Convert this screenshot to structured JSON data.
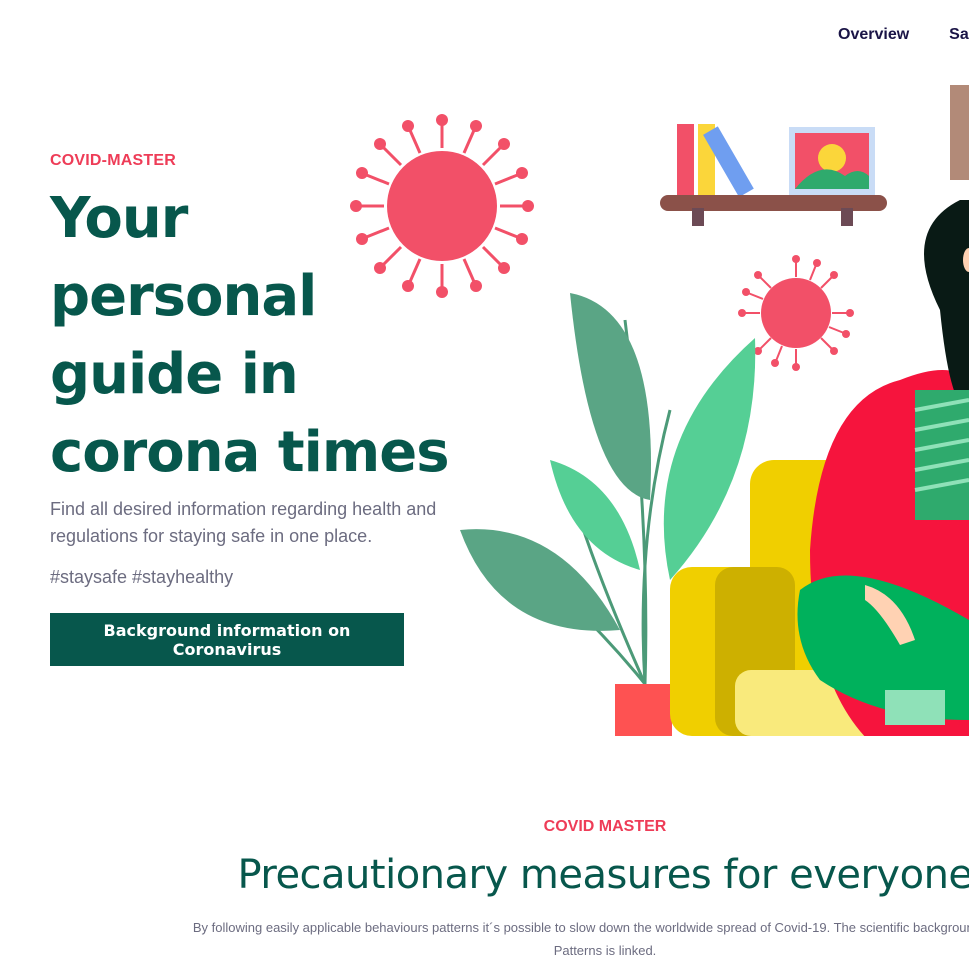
{
  "nav": {
    "items": [
      "Overview",
      "Sa"
    ]
  },
  "hero": {
    "eyebrow": "COVID-MASTER",
    "title": "Your personal guide in corona times",
    "subtitle": "Find all desired information regarding health and regulations for staying safe in one place.",
    "hashtags": "#staysafe #stayhealthy",
    "cta_label": "Background information on Coronavirus"
  },
  "section": {
    "eyebrow": "COVID MASTER",
    "title": "Precautionary measures for everyone",
    "body_line1": "By following easily applicable behaviours patterns it´s possible to slow down the worldwide spread of Covid-19. The scientific background of the",
    "body_line2": "Patterns is linked."
  },
  "colors": {
    "brand_green": "#07574c",
    "accent_red": "#ee3c57",
    "text_gray": "#6c6c80",
    "nav_dark": "#1a1446"
  }
}
